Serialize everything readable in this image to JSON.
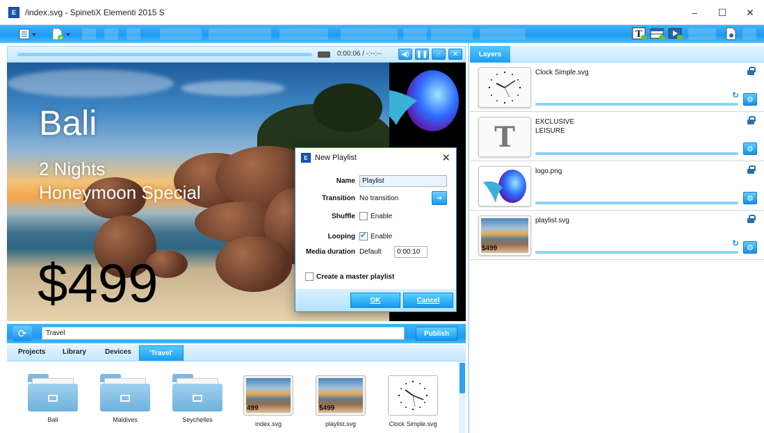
{
  "window": {
    "title": "/index.svg - SpinetiX Elementi 2015 S",
    "app_icon": "E",
    "controls": {
      "minimize": "–",
      "maximize": "☐",
      "close": "✕"
    }
  },
  "toolbar": {
    "main_menu_icon": "☰",
    "new_icon": "+"
  },
  "preview": {
    "time": "0:00:06 / -:--:--",
    "promo": {
      "title": "Bali",
      "line1": "2 Nights",
      "line2": "Honeymoon Special",
      "price": "$499"
    }
  },
  "dialog": {
    "title": "New Playlist",
    "close": "✕",
    "name_label": "Name",
    "name_value": "Playlist",
    "transition_label": "Transition",
    "transition_value": "No transition",
    "shuffle_label": "Shuffle",
    "shuffle_text": "Enable",
    "shuffle_checked": false,
    "looping_label": "Looping",
    "looping_text": "Enable",
    "looping_checked": true,
    "media_duration_label": "Media duration",
    "media_duration_mode": "Default",
    "media_duration_value": "0:00:10",
    "master_playlist_label": "Create a master playlist",
    "ok": "OK",
    "cancel": "Cancel"
  },
  "publish_bar": {
    "refresh_icon": "⟳",
    "path_value": "Travel",
    "publish": "Publish"
  },
  "tabs": [
    {
      "label": "Projects"
    },
    {
      "label": "Library"
    },
    {
      "label": "Devices"
    },
    {
      "label": "'Travel'"
    }
  ],
  "library": {
    "items": [
      {
        "label": "Bali",
        "kind": "folder"
      },
      {
        "label": "Maldives",
        "kind": "folder"
      },
      {
        "label": "Seychelles",
        "kind": "folder"
      },
      {
        "label": "index.svg",
        "kind": "image",
        "price": "499"
      },
      {
        "label": "playlist.svg",
        "kind": "image",
        "price": "$499"
      },
      {
        "label": "Clock Simple.svg",
        "kind": "clock"
      }
    ]
  },
  "layers": {
    "tab": "Layers",
    "rows": [
      {
        "name": "Clock Simple.svg",
        "kind": "clock",
        "sync": true
      },
      {
        "name": "EXCLUSIVE\nLEISURE",
        "kind": "text",
        "thumb_glyph": "T",
        "sync": false
      },
      {
        "name": "logo.png",
        "kind": "logo",
        "sync": false
      },
      {
        "name": "playlist.svg",
        "kind": "image",
        "price": "$499",
        "sync": true
      }
    ]
  },
  "colors": {
    "accent": "#1e9af0",
    "accent_light": "#57c6ff",
    "panel_bg": "#e4f4ff"
  }
}
